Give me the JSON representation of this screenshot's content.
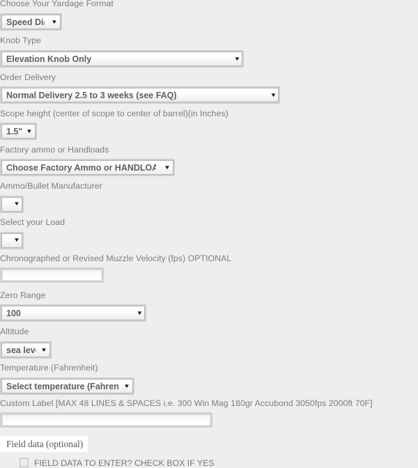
{
  "page": {
    "background_color": "#eeeeee",
    "label_color": "#7d7d7d",
    "value_color": "#5f5f5f"
  },
  "fields": [
    {
      "key": "yardage_format",
      "label": "Choose Your Yardage Format",
      "type": "select",
      "value": "Speed Dial"
    },
    {
      "key": "knob_type",
      "label": "Knob Type",
      "type": "select",
      "value": "Elevation Knob Only"
    },
    {
      "key": "order_delivery",
      "label": "Order Delivery",
      "type": "select",
      "value": "Normal Delivery 2.5 to 3 weeks (see FAQ)"
    },
    {
      "key": "scope_height",
      "label": "Scope height (center of scope to center of barrel)(in Inches)",
      "type": "select",
      "value": "1.5\""
    },
    {
      "key": "ammo_type",
      "label": "Factory ammo or Handloads",
      "type": "select",
      "value": "Choose Factory Ammo or HANDLOADS"
    },
    {
      "key": "ammo_manufacturer",
      "label": "Ammo/Bullet Manufacturer",
      "type": "select",
      "value": ""
    },
    {
      "key": "load",
      "label": "Select your Load",
      "type": "select",
      "value": ""
    },
    {
      "key": "muzzle_velocity",
      "label": "Chronographed or Revised Muzzle Velocity (fps) OPTIONAL",
      "type": "text",
      "value": "",
      "placeholder": ""
    },
    {
      "key": "zero_range",
      "label": "Zero Range",
      "type": "select",
      "value": "100"
    },
    {
      "key": "altitude",
      "label": "Altitude",
      "type": "select",
      "value": "sea level"
    },
    {
      "key": "temperature",
      "label": "Temperature (Fahrenheit)",
      "type": "select",
      "value": "Select temperature (Fahrenheit)"
    },
    {
      "key": "custom_label",
      "label": "Custom Label [MAX 48 LINES & SPACES i.e. 300 Win Mag 180gr Accubond 3050fps 2000ft 70F]",
      "type": "text",
      "value": "",
      "placeholder": ""
    }
  ],
  "fieldset": {
    "legend": "Field data (optional)",
    "checkbox": {
      "label": "FIELD DATA TO ENTER? CHECK BOX IF YES",
      "checked": false
    }
  },
  "icons": {
    "caret": "▼"
  }
}
